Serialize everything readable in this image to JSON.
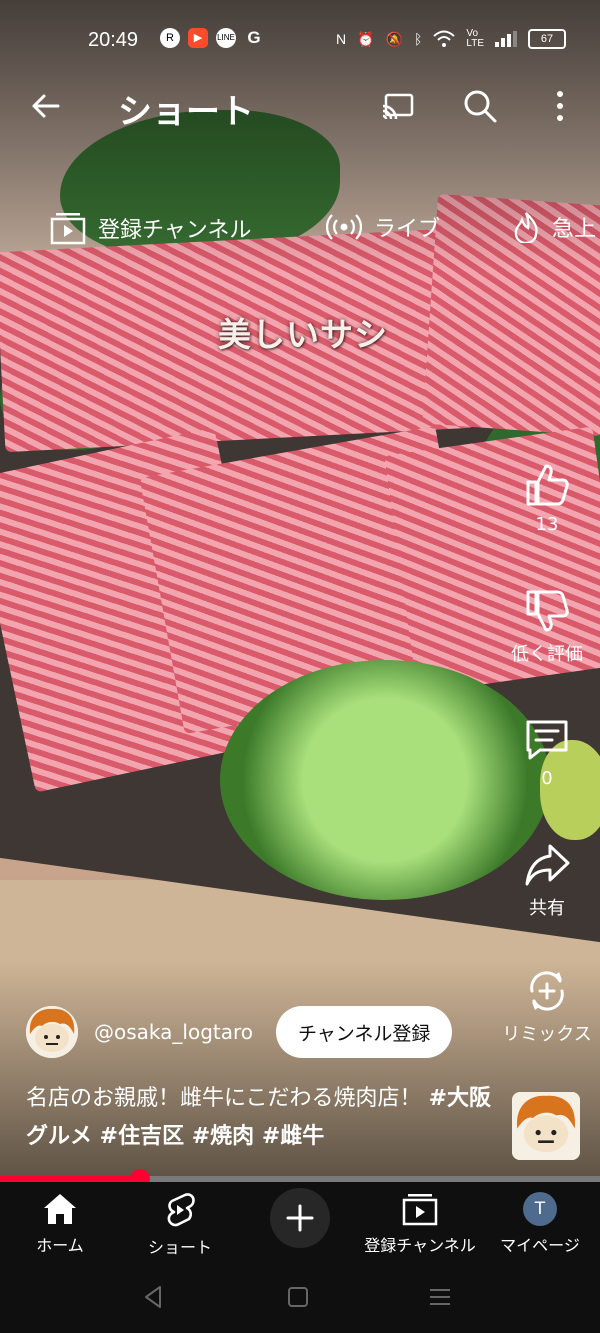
{
  "status_bar": {
    "time": "20:49",
    "battery": "67",
    "left_icons": [
      "rakuten-icon",
      "youtube-icon",
      "line-icon",
      "google-icon"
    ],
    "right_icons": [
      "nfc-icon",
      "alarm-icon",
      "mute-icon",
      "bluetooth-icon",
      "wifi-icon",
      "volte-icon",
      "signal-icon",
      "battery-icon"
    ]
  },
  "header": {
    "title": "ショート"
  },
  "chips": [
    {
      "label": "登録チャンネル",
      "icon": "subscriptions-icon"
    },
    {
      "label": "ライブ",
      "icon": "live-icon"
    },
    {
      "label": "急上",
      "icon": "trending-icon"
    }
  ],
  "video": {
    "overlay_text": "美しいサシ"
  },
  "actions": {
    "like_count": "13",
    "dislike_label": "低く評価",
    "comment_count": "0",
    "share_label": "共有",
    "remix_label": "リミックス"
  },
  "channel": {
    "handle": "@osaka_logtaro",
    "subscribe_label": "チャンネル登録"
  },
  "caption": {
    "text": "名店のお親戚！雌牛にこだわる焼肉店！",
    "hashtags": "#大阪グルメ #住吉区 #焼肉 #雌牛"
  },
  "progress": {
    "fraction": 0.233
  },
  "bottom_nav": {
    "home": "ホーム",
    "shorts": "ショート",
    "subscriptions": "登録チャンネル",
    "you": "マイページ",
    "avatar_letter": "T"
  },
  "colors": {
    "accent": "#ff0033",
    "background": "#0f0f0f"
  }
}
